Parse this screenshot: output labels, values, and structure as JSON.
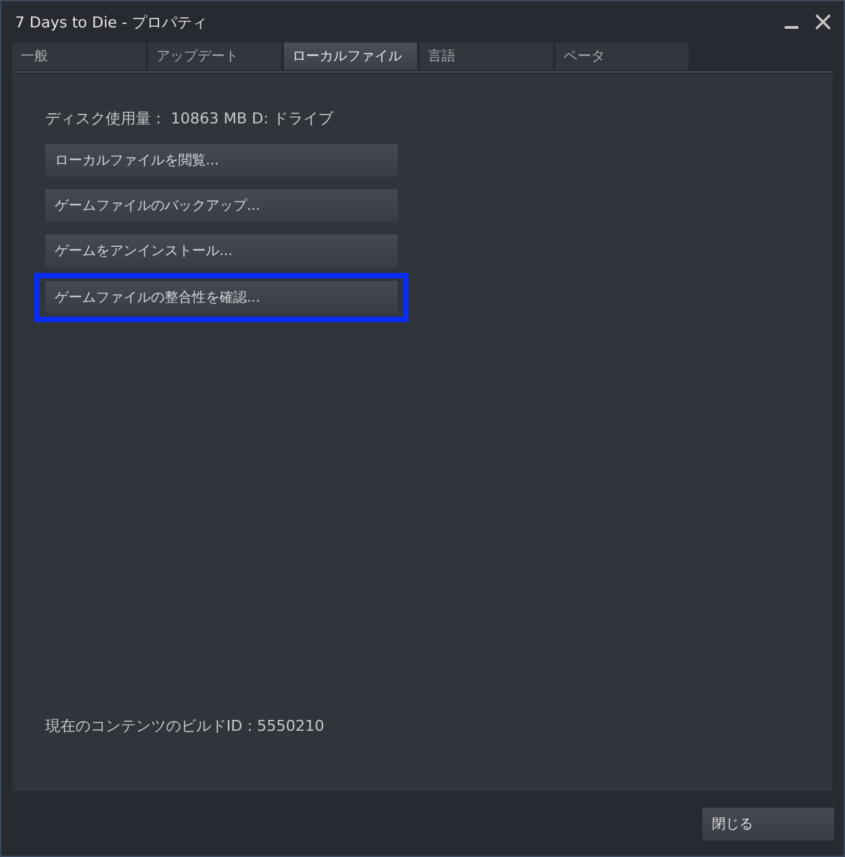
{
  "window": {
    "title": "7 Days to Die - プロパティ"
  },
  "tabs": [
    {
      "label": "一般",
      "selected": false
    },
    {
      "label": "アップデート",
      "selected": false
    },
    {
      "label": "ローカルファイル",
      "selected": true
    },
    {
      "label": "言語",
      "selected": false
    },
    {
      "label": "ベータ",
      "selected": false
    }
  ],
  "disk_usage": "ディスク使用量： 10863 MB D: ドライブ",
  "buttons": [
    {
      "label": "ローカルファイルを閲覧...",
      "highlighted": false
    },
    {
      "label": "ゲームファイルのバックアップ...",
      "highlighted": false
    },
    {
      "label": "ゲームをアンインストール...",
      "highlighted": false
    },
    {
      "label": "ゲームファイルの整合性を確認...",
      "highlighted": true
    }
  ],
  "build_id": "現在のコンテンツのビルドID : 5550210",
  "close_button": "閉じる"
}
